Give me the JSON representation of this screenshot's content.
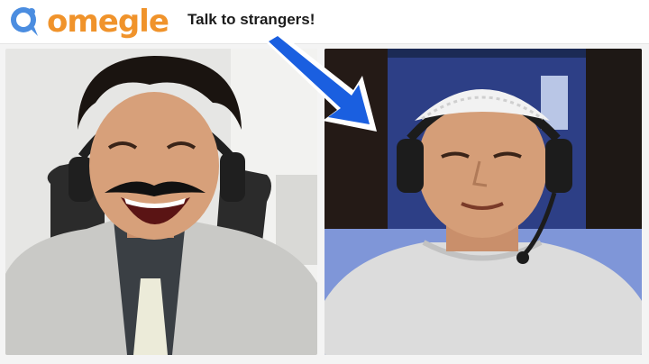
{
  "header": {
    "logo_text": "omegle",
    "tagline": "Talk to strangers!"
  },
  "colors": {
    "logo_orange": "#f0932b",
    "logo_blue": "#4b8de0",
    "arrow_blue": "#1a5fe0",
    "left_bg": "#e6e6e4",
    "right_bg": "#1b2a55"
  },
  "icons": {
    "logo": "omegle-logo-icon",
    "arrow": "pointer-arrow-icon"
  }
}
